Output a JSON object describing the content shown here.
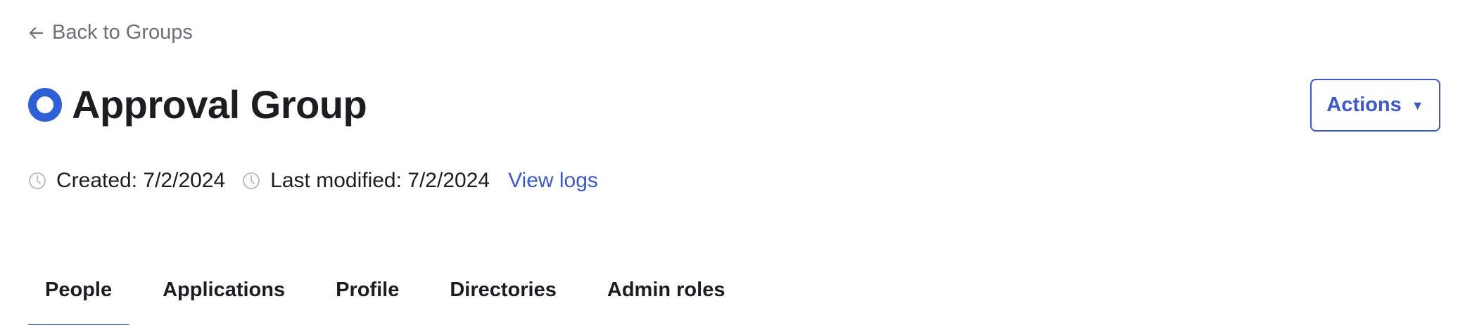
{
  "back_link": {
    "label": "Back to Groups",
    "icon": "arrow-left-icon"
  },
  "header": {
    "title": "Approval Group",
    "icon": "group-circle-icon",
    "icon_color": "#2d5fd6"
  },
  "actions_button": {
    "label": "Actions",
    "icon": "caret-down-icon",
    "accent": "#3b59c9"
  },
  "meta": {
    "created": "Created: 7/2/2024",
    "last_modified": "Last modified: 7/2/2024",
    "view_logs": "View logs",
    "icon": "clock-icon"
  },
  "tabs": [
    {
      "label": "People",
      "active": true
    },
    {
      "label": "Applications",
      "active": false
    },
    {
      "label": "Profile",
      "active": false
    },
    {
      "label": "Directories",
      "active": false
    },
    {
      "label": "Admin roles",
      "active": false
    }
  ]
}
